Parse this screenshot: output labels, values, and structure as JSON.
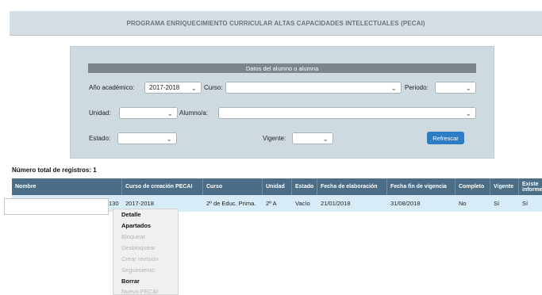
{
  "banner": {
    "title": "PROGRAMA ENRIQUECIMIENTO CURRICULAR ALTAS CAPACIDADES INTELECTUALES (PECAI)"
  },
  "filters": {
    "header": "Datos del alumno o alumna",
    "academic_year": {
      "label": "Año académico:",
      "value": "2017-2018"
    },
    "course": {
      "label": "Curso:",
      "value": ""
    },
    "period": {
      "label": "Periodo:",
      "value": ""
    },
    "unit": {
      "label": "Unidad:",
      "value": ""
    },
    "student": {
      "label": "Alumno/a:",
      "value": ""
    },
    "state": {
      "label": "Estado:",
      "value": ""
    },
    "valid": {
      "label": "Vigente:",
      "value": ""
    },
    "refresh_label": "Refrescar",
    "chevron": "chevron-down-icon"
  },
  "results": {
    "total_label": "Número total de registros: 1",
    "columns": [
      "Nombre",
      "Curso de creación PECAI",
      "Curso",
      "Unidad",
      "Estado",
      "Fecha de elaboración",
      "Fecha fin de vigencia",
      "Completo",
      "Vigente",
      "Existe informe"
    ],
    "rows": [
      {
        "name_suffix": "130",
        "creation_course": "2017-2018",
        "course": "2º de Educ. Prima.",
        "unit": "2º A",
        "state": "Vacío",
        "elaboration_date": "21/01/2018",
        "end_date": "31/08/2018",
        "complete": "No",
        "valid": "Sí",
        "report": "Sí"
      }
    ]
  },
  "context_menu": {
    "items": [
      {
        "label": "Detalle",
        "enabled": true
      },
      {
        "label": "Apartados",
        "enabled": true
      },
      {
        "label": "Bloquear",
        "enabled": false
      },
      {
        "label": "Desbloquear",
        "enabled": false
      },
      {
        "label": "Crear revisión",
        "enabled": false
      },
      {
        "label": "Seguimiento",
        "enabled": false
      },
      {
        "label": "Borrar",
        "enabled": true
      },
      {
        "label": "Nuevo PECAI",
        "enabled": false
      }
    ]
  },
  "colors": {
    "banner_bg": "#d4dee4",
    "panel_bg": "#cfdae0",
    "table_header": "#4b6d85",
    "selected_row": "#d7ecf7",
    "refresh_button": "#2e7dc4"
  }
}
